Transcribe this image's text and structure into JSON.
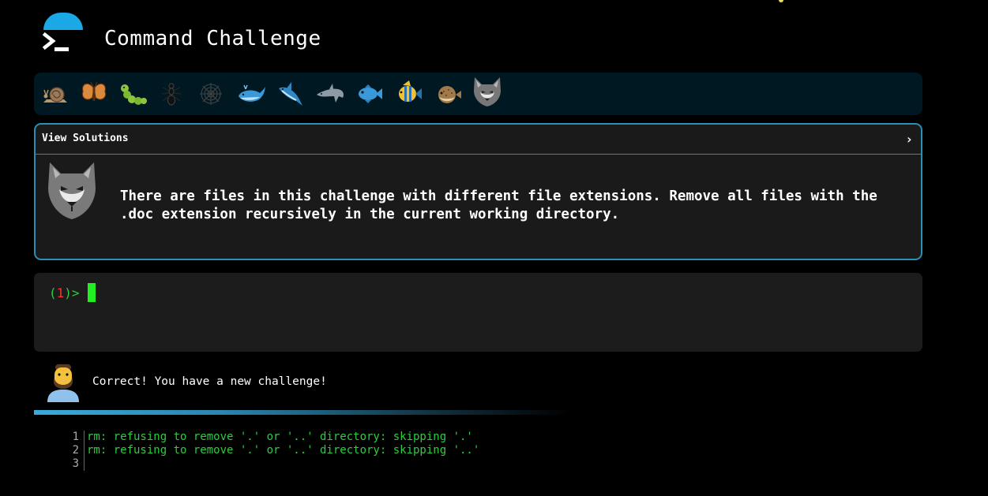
{
  "header": {
    "title": "Command Challenge"
  },
  "levels": [
    {
      "name": "snail-level-icon"
    },
    {
      "name": "butterfly-level-icon"
    },
    {
      "name": "caterpillar-level-icon"
    },
    {
      "name": "ant-level-icon"
    },
    {
      "name": "spiderweb-level-icon"
    },
    {
      "name": "whale-level-icon"
    },
    {
      "name": "shark-level-icon"
    },
    {
      "name": "dolphin-level-icon"
    },
    {
      "name": "fish-level-icon"
    },
    {
      "name": "tropical-fish-level-icon"
    },
    {
      "name": "blowfish-level-icon"
    },
    {
      "name": "wolf-level-icon",
      "active": true
    }
  ],
  "challenge": {
    "view_solutions_label": "View Solutions",
    "chevron": "›",
    "text": "There are files in this challenge with different file extensions. Remove all files with the .doc extension recursively in the current working directory."
  },
  "terminal": {
    "prompt_open": "(",
    "prompt_number": "1",
    "prompt_close": ")>"
  },
  "feedback": {
    "message": "Correct! You have a new challenge!"
  },
  "output": {
    "lines": [
      {
        "number": "1",
        "text": "rm: refusing to remove '.' or '..' directory: skipping '.'"
      },
      {
        "number": "2",
        "text": "rm: refusing to remove '.' or '..' directory: skipping '..'"
      },
      {
        "number": "3",
        "text": ""
      }
    ]
  },
  "colors": {
    "accent": "#2a8fb3",
    "prompt_green": "#2ecc40",
    "prompt_number_red": "#ff3030",
    "cursor": "#22ee22",
    "level_bar_bg": "#001822"
  }
}
